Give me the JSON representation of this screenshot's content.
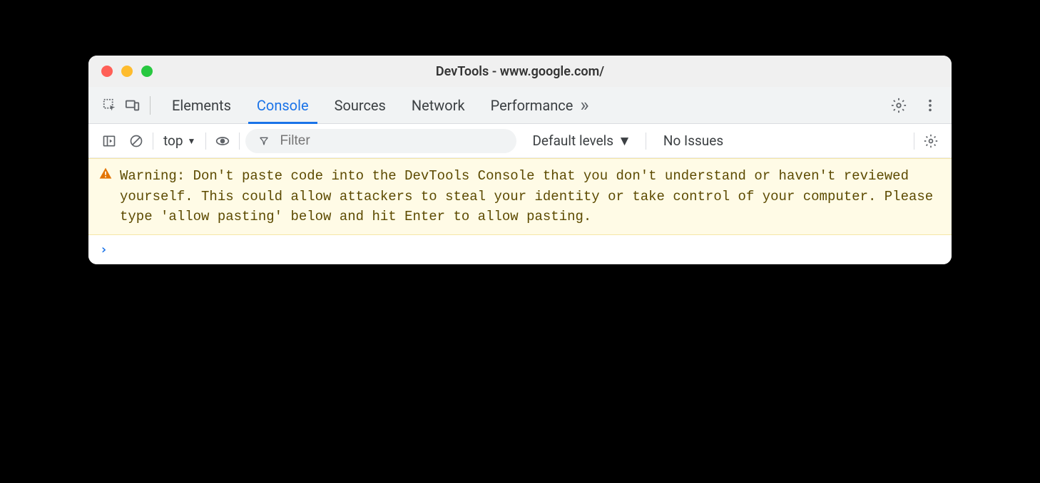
{
  "window": {
    "title": "DevTools - www.google.com/"
  },
  "tabs": {
    "items": [
      "Elements",
      "Console",
      "Sources",
      "Network",
      "Performance"
    ],
    "active": "Console",
    "more_glyph": "»"
  },
  "console_toolbar": {
    "context": "top",
    "filter_placeholder": "Filter",
    "levels_label": "Default levels",
    "issues_label": "No Issues"
  },
  "warning": {
    "text": "Warning: Don't paste code into the DevTools Console that you don't understand or haven't reviewed yourself. This could allow attackers to steal your identity or take control of your computer. Please type 'allow pasting' below and hit Enter to allow pasting."
  },
  "prompt": {
    "symbol": "›"
  }
}
